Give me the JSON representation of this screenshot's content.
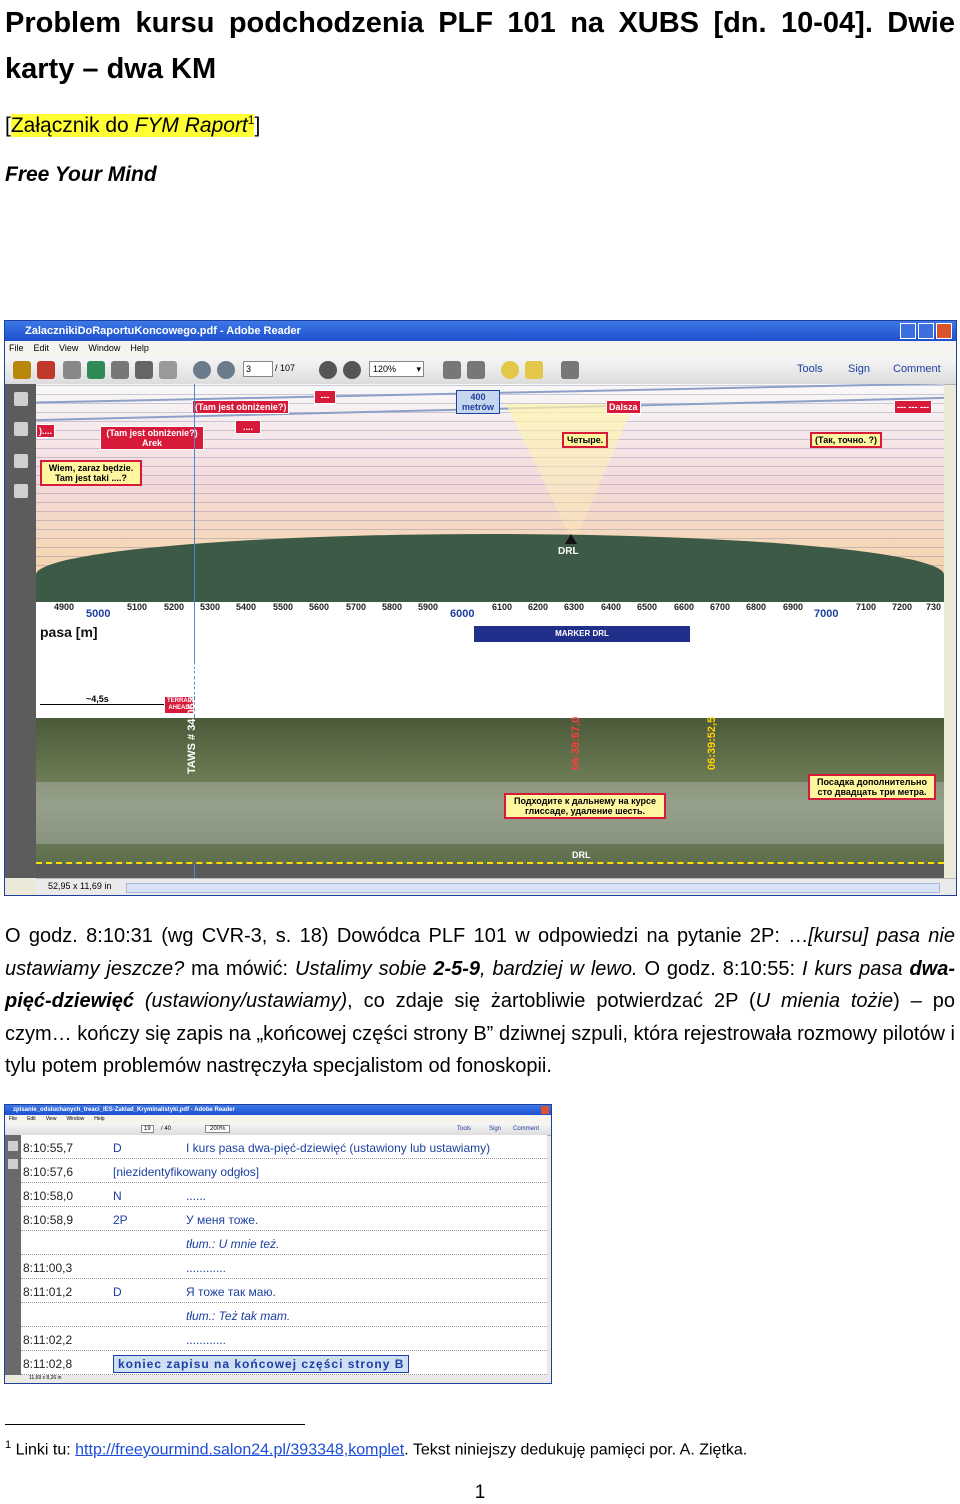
{
  "heading": {
    "title": "Problem kursu podchodzenia PLF 101 na XUBS [dn. 10-04]. Dwie karty – dwa KM",
    "attachment_open": "[",
    "attachment_text": "Załącznik do ",
    "attachment_italic": "FYM Raport",
    "attachment_sup": "1",
    "attachment_close": "]",
    "fym": "Free Your Mind"
  },
  "screenshot1": {
    "window_title": "ZalacznikiDoRaportuKoncowego.pdf - Adobe Reader",
    "menu": [
      "File",
      "Edit",
      "View",
      "Window",
      "Help"
    ],
    "page_current": "3",
    "page_total": "/ 107",
    "zoom": "120%",
    "panels": [
      "Tools",
      "Sign",
      "Comment"
    ],
    "labels": {
      "l1": "(Tam jest obniżenie?)",
      "l2": "(Tam jest obniżenie?) Arek",
      "l3": "Wiem, zaraz będzie. Tam jest taki ....?",
      "l4": "....",
      "l5": "400 metrów",
      "l6": "Dalsza",
      "l7": "Четыре.",
      "l8": "(Так, точно. ?)",
      "l9": "--- --- ---",
      "l10": ")....",
      "l11": "---"
    },
    "drl": "DRL",
    "ticks": [
      "4900",
      "5000",
      "5100",
      "5200",
      "5300",
      "5400",
      "5500",
      "5600",
      "5700",
      "5800",
      "5900",
      "6000",
      "6100",
      "6200",
      "6300",
      "6400",
      "6500",
      "6600",
      "6700",
      "6800",
      "6900",
      "7000",
      "7100",
      "7200",
      "730"
    ],
    "pasa": "pasa [m]",
    "marker": "MARKER DRL",
    "arrow_label": "~4,5s",
    "terrain": "TERRAIN AHEAD",
    "taws": "TAWS # 34 06:40:09,0",
    "t1": "06:39:57,0",
    "t2": "06:39:52,5",
    "ru1": "Подходите к дальнему на курсе глиссаде, удаление шесть.",
    "ru2": "Посадка дополнительно сто двадцать три метра.",
    "drl_bottom": "DRL",
    "status": "52,95 x 11,69 in"
  },
  "paragraph": {
    "p1": "O godz. 8:10:31 (wg CVR-3, s. 18) Dowódca PLF 101 w odpowiedzi na pytanie 2P: …",
    "p2": "[kursu] pasa nie ustawiamy jeszcze?",
    "p3": " ma mówić: ",
    "p4": "Ustalimy sobie ",
    "p5": "2-5-9",
    "p6": ", bardziej w lewo.",
    "p7": " O godz. 8:10:55: ",
    "p8": "I kurs pasa ",
    "p9": "dwa-pięć-dziewięć",
    "p10": " (ustawiony/ustawiamy)",
    "p11": ", co zdaje się żartobliwie potwierdzać 2P (",
    "p12": "U mienia tożie",
    "p13": ") – po czym… kończy się zapis na „końcowej części strony B” dziwnej szpuli, która rejestrowała rozmowy pilotów i tylu potem problemów nastręczyła specjalistom od fonoskopii."
  },
  "screenshot2": {
    "window_title": "zpisanie_odsluchanych_treaci_IES-Zaklad_Kryminalistyki.pdf - Adobe Reader",
    "menu": [
      "File",
      "Edit",
      "View",
      "Window",
      "Help"
    ],
    "page_current": "19",
    "page_total": "/ 40",
    "zoom": "200%",
    "panels": [
      "Tools",
      "Sign",
      "Comment"
    ],
    "rows": [
      {
        "time": "8:10:55,7",
        "spk": "D",
        "txt": "I kurs pasa dwa-pięć-dziewięć (ustawiony lub ustawiamy)"
      },
      {
        "time": "8:10:57,6",
        "spk": "[niezidentyfikowany odgłos]",
        "txt": ""
      },
      {
        "time": "8:10:58,0",
        "spk": "N",
        "txt": "......"
      },
      {
        "time": "8:10:58,9",
        "spk": "2P",
        "txt": "У меня тоже."
      },
      {
        "time": "",
        "spk": "",
        "txt": "tłum.: U mnie też."
      },
      {
        "time": "8:11:00,3",
        "spk": "",
        "txt": "............"
      },
      {
        "time": "8:11:01,2",
        "spk": "D",
        "txt": "Я тоже так маю."
      },
      {
        "time": "",
        "spk": "",
        "txt": "tłum.: Też tak mam."
      },
      {
        "time": "8:11:02,2",
        "spk": "",
        "txt": "............"
      },
      {
        "time": "8:11:02,8",
        "spk": "koniec zapisu na końcowej części strony B",
        "txt": ""
      }
    ],
    "status": "11,69 x 8,26 in"
  },
  "footnote": {
    "sup": "1",
    "lead": " Linki tu: ",
    "link": "http://freeyourmind.salon24.pl/393348,komplet",
    "tail": ". Tekst niniejszy dedukuję pamięci por. A. Ziętka."
  },
  "page_number": "1",
  "colors": {
    "accent_blue": "#1d3fa0",
    "label_red": "#d7193a",
    "highlight": "#ffff33"
  }
}
